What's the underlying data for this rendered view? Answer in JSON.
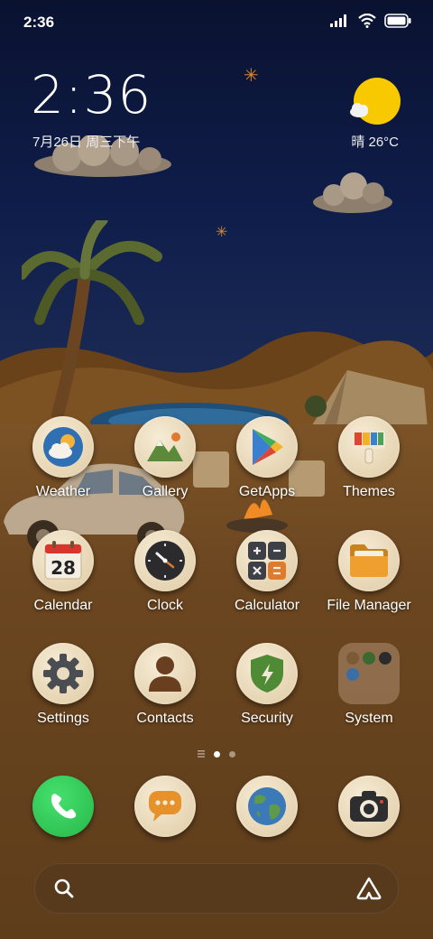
{
  "status_bar": {
    "time": "2:36"
  },
  "widget": {
    "time": "2:36",
    "date": "7月26日 周三下午",
    "weather": "晴 26°C"
  },
  "apps": [
    {
      "label": "Weather"
    },
    {
      "label": "Gallery"
    },
    {
      "label": "GetApps"
    },
    {
      "label": "Themes"
    },
    {
      "label": "Calendar",
      "day": "28"
    },
    {
      "label": "Clock"
    },
    {
      "label": "Calculator"
    },
    {
      "label": "File Manager"
    },
    {
      "label": "Settings"
    },
    {
      "label": "Contacts"
    },
    {
      "label": "Security"
    },
    {
      "label": "System"
    }
  ],
  "pager": {
    "pages": 2,
    "active": 1
  },
  "dock": [
    {
      "name": "phone-icon"
    },
    {
      "name": "messages-icon"
    },
    {
      "name": "browser-globe-icon"
    },
    {
      "name": "camera-icon"
    }
  ],
  "colors": {
    "sky": "#0f1d4a",
    "sand": "#6b4620",
    "felt_icon": "#e6d4b2",
    "phone_green": "#2fd05b",
    "sun_yellow": "#f9c900"
  }
}
